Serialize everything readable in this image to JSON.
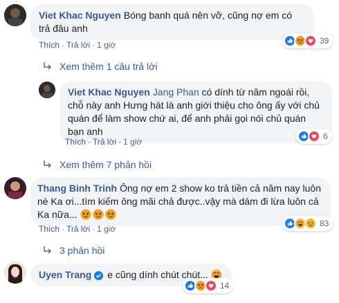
{
  "comments": [
    {
      "author": "Viet Khac Nguyen",
      "text": "Bóng banh quá nên vỡ, cũng nợ em có trả đâu anh",
      "like_label": "Thích",
      "reply_label": "Trả lời",
      "time": "1 giờ",
      "reaction_count": "39"
    },
    {
      "author": "Viet Khac Nguyen",
      "tagged": "Jang Phan",
      "text": "có dính từ năm ngoái rồi, chỗ này anh Hưng hát là anh giới thiệu cho ông ấy với chủ quán để làm show chứ ai, để anh phải gọi nói chủ quán bạn anh",
      "like_label": "Thích",
      "reply_label": "Trả lời",
      "time": "1 giờ",
      "reaction_count": "6"
    },
    {
      "author": "Thang Binh Trinh",
      "text": "Ông nợ em 2 show ko trả tiền cả năm nay luôn nè Ka ơi...tìm kiếm ông mãi chả được..vậy mà dám đi lừa luôn cả Ka nữa...",
      "like_label": "Thích",
      "reply_label": "Trả lời",
      "time": "1 giờ",
      "reaction_count": "83"
    },
    {
      "author": "Uyen Trang",
      "text": "e cũng dính chút chút...",
      "reaction_count": "14"
    }
  ],
  "more_links": {
    "replies_1": "Xem thêm 1 câu trả lời",
    "replies_7": "Xem thêm 7 phản hồi",
    "replies_3": "3 phản hồi"
  },
  "colors": {
    "link": "#385898",
    "bubble": "#f2f3f5",
    "meta": "#606770",
    "like": "#1877f2",
    "love": "#f33e58",
    "angry": "#e9710f",
    "haha": "#f7b125"
  }
}
